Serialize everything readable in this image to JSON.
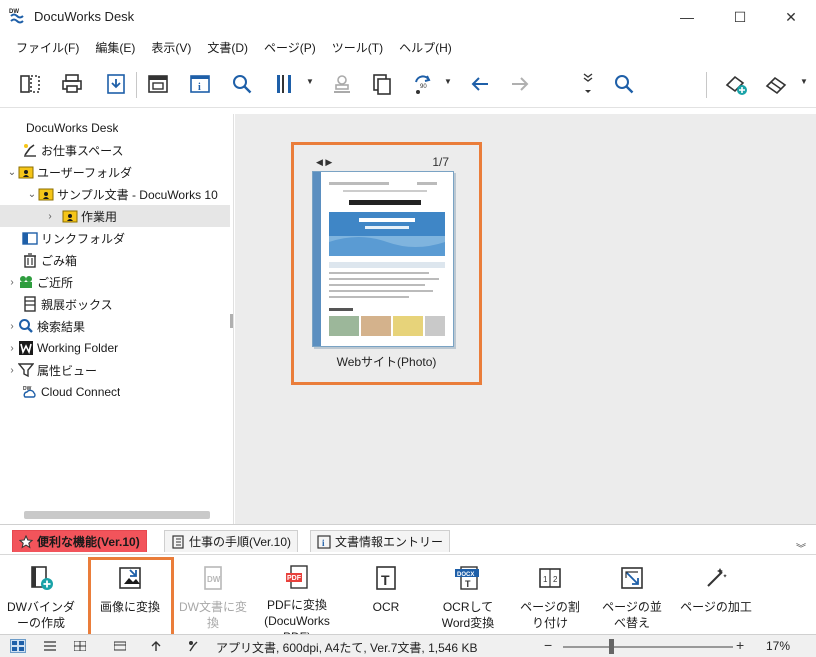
{
  "window": {
    "title": "DocuWorks Desk",
    "minimize": "—",
    "maximize": "☐",
    "close": "✕"
  },
  "menu": [
    "ファイル(F)",
    "編集(E)",
    "表示(V)",
    "文書(D)",
    "ページ(P)",
    "ツール(T)",
    "ヘルプ(H)"
  ],
  "tree": {
    "items": [
      {
        "label": "DocuWorks Desk",
        "icon": "none"
      },
      {
        "label": "お仕事スペース",
        "icon": "workspace-icon"
      },
      {
        "label": "ユーザーフォルダ",
        "icon": "user-folder-icon"
      },
      {
        "label": "サンプル文書 - DocuWorks 10",
        "icon": "user-folder-icon"
      },
      {
        "label": "作業用",
        "icon": "user-folder-icon"
      },
      {
        "label": "リンクフォルダ",
        "icon": "link-folder-icon"
      },
      {
        "label": "ごみ箱",
        "icon": "trash-icon"
      },
      {
        "label": "ご近所",
        "icon": "neighbors-icon"
      },
      {
        "label": "親展ボックス",
        "icon": "confidential-box-icon"
      },
      {
        "label": "検索結果",
        "icon": "search-icon"
      },
      {
        "label": "Working Folder",
        "icon": "working-folder-icon"
      },
      {
        "label": "属性ビュー",
        "icon": "filter-icon"
      },
      {
        "label": "Cloud Connect",
        "icon": "cloud-connect-icon"
      }
    ]
  },
  "document": {
    "page": "1/7",
    "name": "Webサイト(Photo)",
    "nav": "◀ ▶"
  },
  "tabs": [
    {
      "label": "便利な機能(Ver.10)",
      "icon": "star-icon",
      "active": true
    },
    {
      "label": "仕事の手順(Ver.10)",
      "icon": "procedure-icon",
      "active": false
    },
    {
      "label": "文書情報エントリー",
      "icon": "doc-info-icon",
      "active": false
    }
  ],
  "functions": [
    {
      "label": "DWバインダーの作成",
      "icon": "binder-add-icon",
      "disabled": false
    },
    {
      "label": "画像に変換",
      "icon": "convert-image-icon",
      "disabled": false
    },
    {
      "label": "DW文書に変換",
      "icon": "convert-dw-icon",
      "disabled": true
    },
    {
      "label": "PDFに変換(DocuWorks PDF)",
      "icon": "convert-pdf-icon",
      "disabled": false
    },
    {
      "label": "OCR",
      "icon": "ocr-icon",
      "disabled": false
    },
    {
      "label": "OCRしてWord変換",
      "icon": "ocr-word-icon",
      "disabled": false
    },
    {
      "label": "ページの割り付け",
      "icon": "page-layout-icon",
      "disabled": false
    },
    {
      "label": "ページの並べ替え",
      "icon": "page-reorder-icon",
      "disabled": false
    },
    {
      "label": "ページの加工",
      "icon": "page-edit-icon",
      "disabled": false
    }
  ],
  "status": {
    "text": "アプリ文書, 600dpi, A4たて, Ver.7文書, 1,546 KB",
    "zoom": "17%",
    "zoom_level": 0.27
  },
  "colors": {
    "highlight": "#ea7d3a",
    "active_tab": "#f2545b",
    "folder_yellow": "#f5c518",
    "accent_blue": "#1e5fa8"
  }
}
